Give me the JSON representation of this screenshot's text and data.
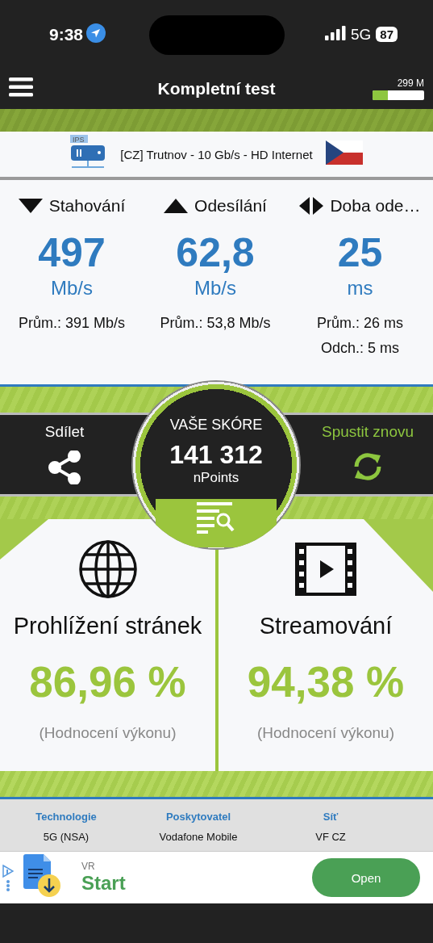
{
  "status_bar": {
    "time": "9:38",
    "network": "5G",
    "battery": "87"
  },
  "app_bar": {
    "title": "Kompletní test",
    "data_label": "299 M",
    "level": 0.3
  },
  "server": {
    "icon_label": "IPS",
    "name": "[CZ] Trutnov - 10 Gb/s - HD Internet"
  },
  "metrics": [
    {
      "kind": "download",
      "label": "Stahování",
      "value": "497",
      "unit": "Mb/s",
      "stats": [
        "Prům.: 391 Mb/s"
      ]
    },
    {
      "kind": "upload",
      "label": "Odesílání",
      "value": "62,8",
      "unit": "Mb/s",
      "stats": [
        "Prům.: 53,8 Mb/s"
      ]
    },
    {
      "kind": "latency",
      "label": "Doba ode…",
      "value": "25",
      "unit": "ms",
      "stats": [
        "Prům.: 26 ms",
        "Odch.: 5 ms"
      ]
    }
  ],
  "score": {
    "title": "VAŠE SKÓRE",
    "value": "141 312",
    "unit": "nPoints"
  },
  "actions": [
    {
      "kind": "share",
      "label": "Sdílet"
    },
    {
      "kind": "restart",
      "label": "Spustit znovu"
    }
  ],
  "categories": [
    {
      "kind": "browsing",
      "title": "Prohlížení stránek",
      "value": "86,96 %",
      "note": "(Hodnocení výkonu)"
    },
    {
      "kind": "streaming",
      "title": "Streamování",
      "value": "94,38 %",
      "note": "(Hodnocení výkonu)"
    }
  ],
  "info": [
    {
      "label": "Technologie",
      "value": "5G (NSA)"
    },
    {
      "label": "Poskytovatel",
      "value": "Vodafone Mobile"
    },
    {
      "label": "Síť",
      "value": "VF CZ"
    }
  ],
  "ad": {
    "brand": "VR",
    "title": "Start",
    "button": "Open"
  }
}
